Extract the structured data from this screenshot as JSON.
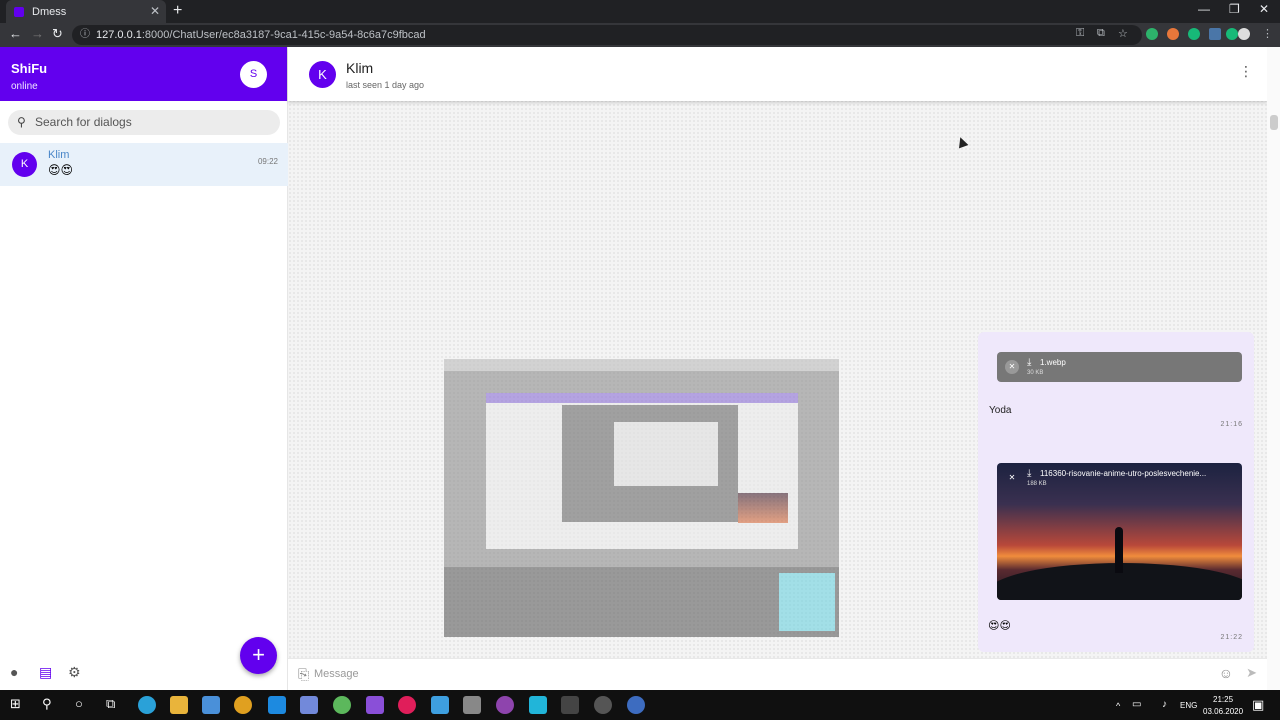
{
  "browser": {
    "tab_title": "Dmess",
    "tab_close": "✕",
    "new_tab": "+",
    "url_host": "127.0.0.1",
    "url_rest": ":8000/ChatUser/ec8a3187-9ca1-415c-9a54-8c6a7c9fbcad",
    "win_min": "—",
    "win_restore": "❐",
    "win_close": "✕"
  },
  "me": {
    "name": "ShiFu",
    "status": "online",
    "avatar_letter": "S"
  },
  "search": {
    "placeholder": "Search for dialogs"
  },
  "dialogs": [
    {
      "avatar_letter": "K",
      "name": "Klim",
      "last": "😍😍",
      "time": "09:22"
    }
  ],
  "chat": {
    "avatar_letter": "K",
    "name": "Klim",
    "seen": "last seen 1 day ago"
  },
  "messages": {
    "file1_name": "1.webp",
    "file1_size": "30 KB",
    "text": "Yoda",
    "time1": "21:16",
    "file2_name": "116360-risovanie-anime-utro-poslesvechenie...",
    "file2_size": "188 KB",
    "emoji": "😍😍",
    "time2": "21:22"
  },
  "compose": {
    "placeholder": "Message"
  },
  "taskbar": {
    "lang": "ENG",
    "time": "21:25",
    "date": "03.06.2020"
  },
  "colors": {
    "accent": "#6200ee",
    "selected_dialog": "#e8f1fa",
    "bubble": "#efe8fb"
  },
  "icons": [
    "search-icon",
    "person-icon",
    "chat-icon",
    "gear-icon",
    "plus-icon",
    "more-icon",
    "attach-icon",
    "emoji-icon",
    "send-icon",
    "download-icon",
    "close-icon"
  ]
}
